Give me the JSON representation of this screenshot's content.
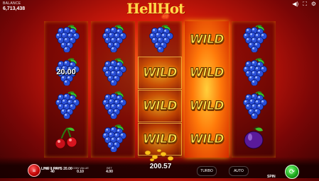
{
  "header": {
    "balance_label": "BALANCE",
    "balance_value": "6,713,438",
    "logo_main": "HellHot",
    "logo_sub": "40"
  },
  "reels": [
    {
      "lit": false,
      "symbols": [
        "grapes",
        "grapes",
        "grapes",
        "cherries"
      ],
      "win_value": "20.00",
      "win_row": 1
    },
    {
      "lit": false,
      "symbols": [
        "grapes",
        "grapes",
        "grapes",
        "grapes"
      ]
    },
    {
      "lit": false,
      "symbols": [
        "grapes",
        "WILD",
        "WILD",
        "WILD"
      ]
    },
    {
      "lit": true,
      "symbols": [
        "WILD",
        "WILD",
        "WILD",
        "WILD"
      ]
    },
    {
      "lit": false,
      "symbols": [
        "grapes",
        "grapes",
        "grapes",
        "plum"
      ]
    }
  ],
  "footer": {
    "line_pays": "LINE 1 PAYS 20.00",
    "fixed_lines_label": "FIXED LINES",
    "fixed_lines_value": "40",
    "coin_value_label": "COIN VALUE",
    "coin_value_value": "0.10",
    "bet_label": "BET",
    "bet_value": "4.00",
    "total_win": "200.57",
    "turbo_label": "TURBO",
    "auto_label": "AUTO",
    "spin_label": "SPIN"
  },
  "colors": {
    "wild_text": "#ffe04a",
    "spin_button": "#17a317",
    "menu_button": "#c00000"
  }
}
